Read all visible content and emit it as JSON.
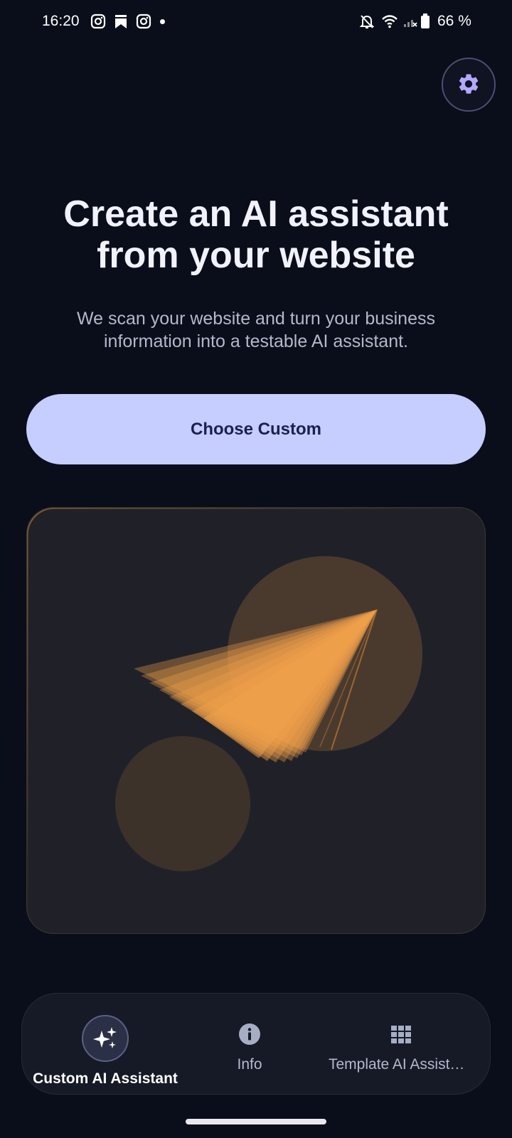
{
  "status_bar": {
    "time": "16:20",
    "battery": "66 %",
    "left_icons": [
      "instagram-icon",
      "bookmark-icon",
      "instagram-icon",
      "notification-dot"
    ],
    "right_icons": [
      "bell-off-icon",
      "wifi-icon",
      "signal-icon",
      "battery-icon"
    ]
  },
  "settings": {
    "icon": "gear-icon"
  },
  "hero": {
    "title": "Create an AI assistant\nfrom your website",
    "subtitle": "We scan your website and turn your business\ninformation into a testable AI assistant."
  },
  "primary_action": {
    "label": "Choose Custom"
  },
  "illustration": {
    "icon": "paper-plane-icon"
  },
  "bottom_nav": {
    "items": [
      {
        "label": "Custom AI Assistant",
        "icon": "sparkles-icon",
        "selected": true
      },
      {
        "label": "Info",
        "icon": "info-icon",
        "selected": false
      },
      {
        "label": "Template AI Assist…",
        "icon": "grid-icon",
        "selected": false
      }
    ]
  },
  "colors": {
    "background": "#0a0e1a",
    "primary_button": "#c6cdff",
    "accent_orange": "#f2a14a",
    "settings_icon": "#b4a8ff"
  }
}
